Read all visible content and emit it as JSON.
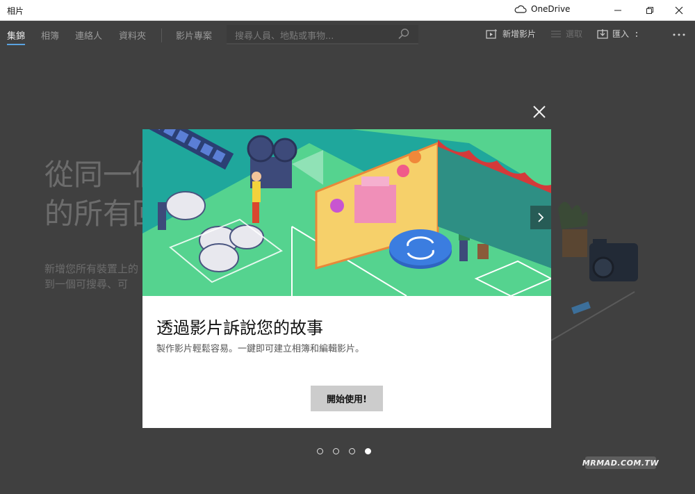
{
  "window": {
    "title": "相片",
    "onedrive_label": "OneDrive"
  },
  "toolbar": {
    "tabs": [
      {
        "label": "集錦",
        "active": true
      },
      {
        "label": "相簿",
        "active": false
      },
      {
        "label": "連絡人",
        "active": false
      },
      {
        "label": "資料夾",
        "active": false
      },
      {
        "label": "影片專案",
        "active": false
      }
    ],
    "search_placeholder": "搜尋人員、地點或事物...",
    "new_video_label": "新增影片",
    "select_label": "選取",
    "import_label": "匯入"
  },
  "background": {
    "heading_line1": "從同一個",
    "heading_line2": "的所有回",
    "body_line1": "新增您所有裝置上的",
    "body_line2": "到一個可搜尋、可"
  },
  "dialog": {
    "title": "透過影片訴說您的故事",
    "subtitle": "製作影片輕鬆容易。一鍵即可建立相簿和編輯影片。",
    "start_button": "開始使用!",
    "page_count": 4,
    "active_page": 4
  },
  "watermark": "MRMAD.COM.TW",
  "colors": {
    "accent": "#5aa3e0",
    "hero_teal": "#1fa79c",
    "hero_green": "#55d38f",
    "overlay": "#404040"
  }
}
